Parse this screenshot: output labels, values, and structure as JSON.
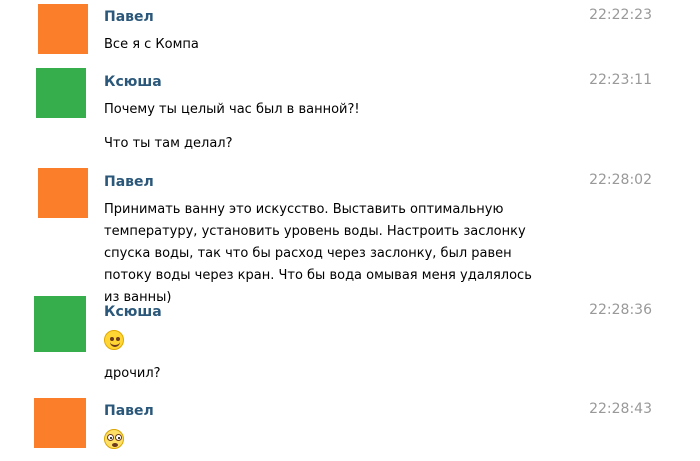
{
  "colors": {
    "pavel_avatar": "#fb7f2a",
    "ksusha_avatar": "#36ae4b",
    "name_color": "#2b587a",
    "time_color": "#999999",
    "emoji_smile": "#ffd633",
    "emoji_surprise": "#ffe066"
  },
  "messages": [
    {
      "author": "Павел",
      "time": "22:22:23",
      "lines": [
        "Все я с Компа"
      ]
    },
    {
      "author": "Ксюша",
      "time": "22:23:11",
      "lines": [
        "Почему ты целый час был в ванной?!",
        "Что ты там делал?"
      ]
    },
    {
      "author": "Павел",
      "time": "22:28:02",
      "text": "Принимать ванну это искусство. Выставить оптимальную температуру, установить уровень воды. Настроить заслонку спуска воды, так что бы расход через заслонку, был равен потоку воды через кран. Что бы вода омывая меня удалялось из ванны)"
    },
    {
      "author": "Ксюша",
      "time": "22:28:36",
      "emoji": "smile-emoji",
      "lines": [
        "дрочил?"
      ]
    },
    {
      "author": "Павел",
      "time": "22:28:43",
      "emoji": "surprised-emoji"
    }
  ]
}
